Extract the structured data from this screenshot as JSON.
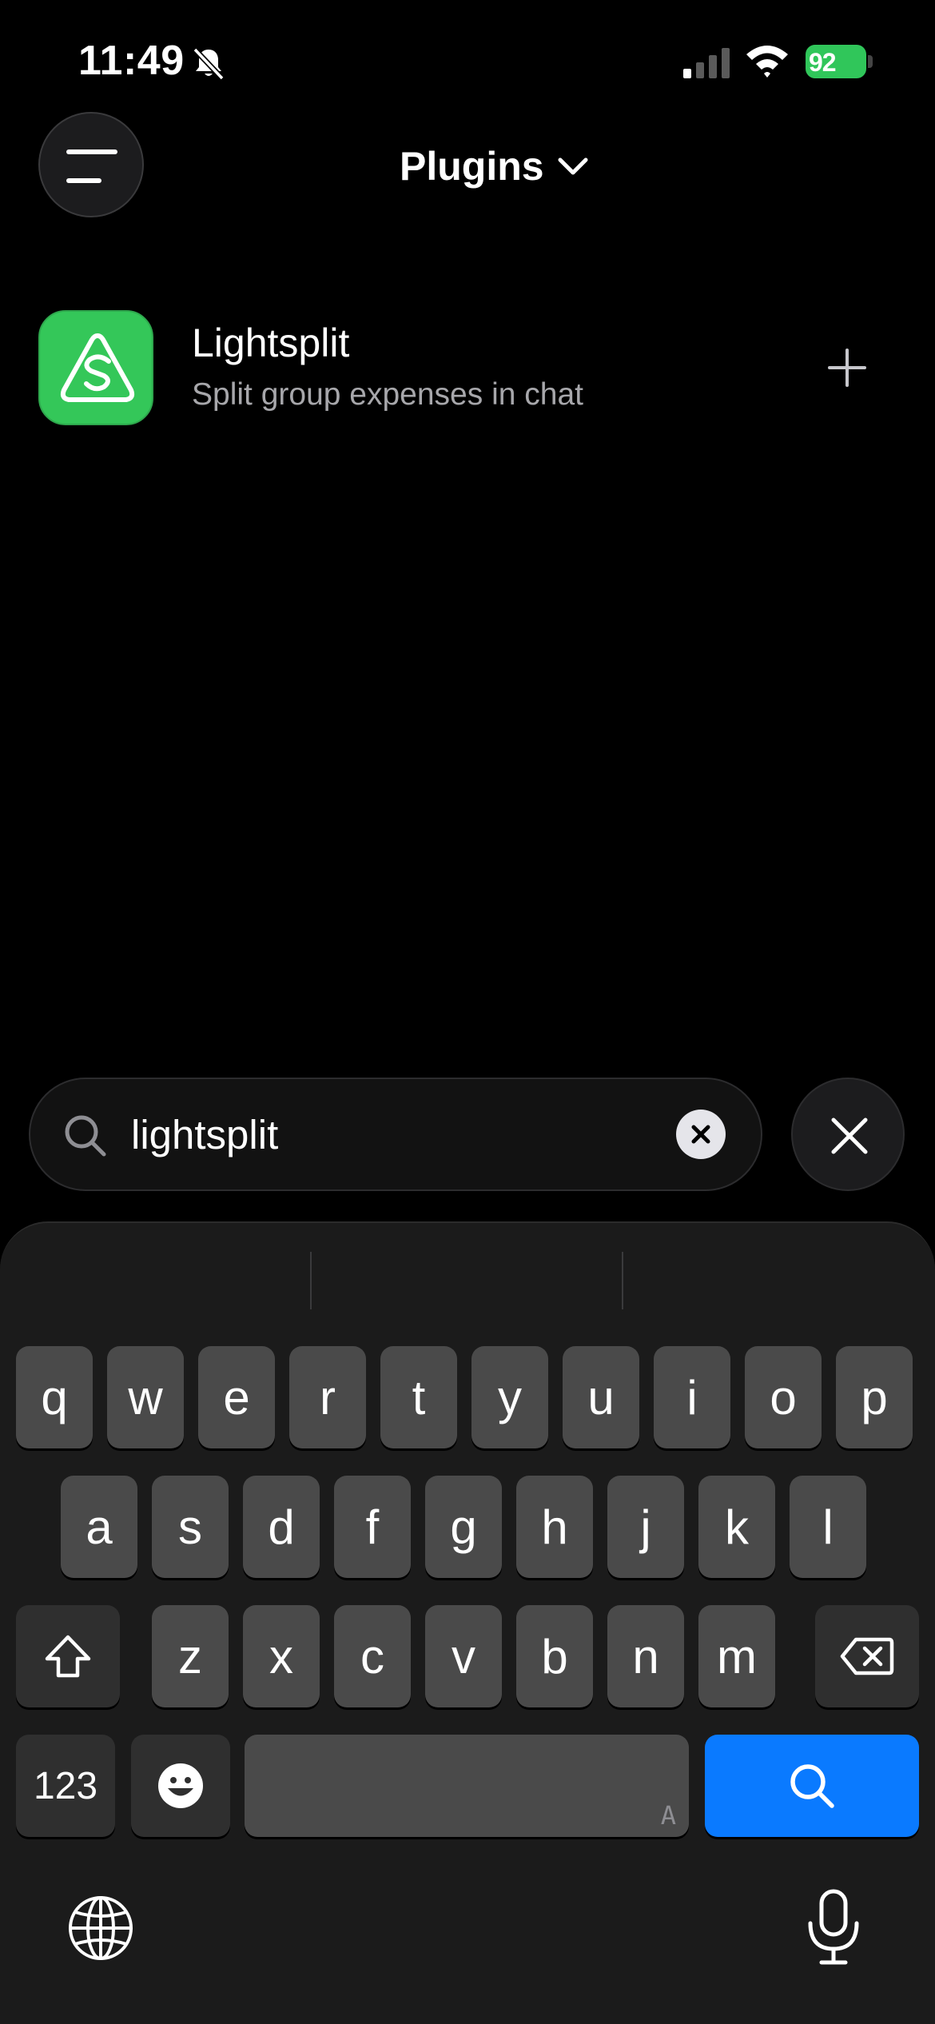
{
  "status_bar": {
    "time": "11:49",
    "battery": "92",
    "battery_color": "#30c65a"
  },
  "header": {
    "title": "Plugins",
    "menu_icon": "hamburger-icon",
    "dropdown_icon": "chevron-down-icon"
  },
  "plugins": [
    {
      "name": "Lightsplit",
      "description": "Split group expenses in chat",
      "icon_color": "#34c759"
    }
  ],
  "search": {
    "value": "lightsplit",
    "placeholder": "Search"
  },
  "keyboard": {
    "row1": [
      "q",
      "w",
      "e",
      "r",
      "t",
      "y",
      "u",
      "i",
      "o",
      "p"
    ],
    "row2": [
      "a",
      "s",
      "d",
      "f",
      "g",
      "h",
      "j",
      "k",
      "l"
    ],
    "row3": [
      "z",
      "x",
      "c",
      "v",
      "b",
      "n",
      "m"
    ],
    "numbers_label": "123",
    "space_hint": "A",
    "action_color": "#0a7aff"
  }
}
